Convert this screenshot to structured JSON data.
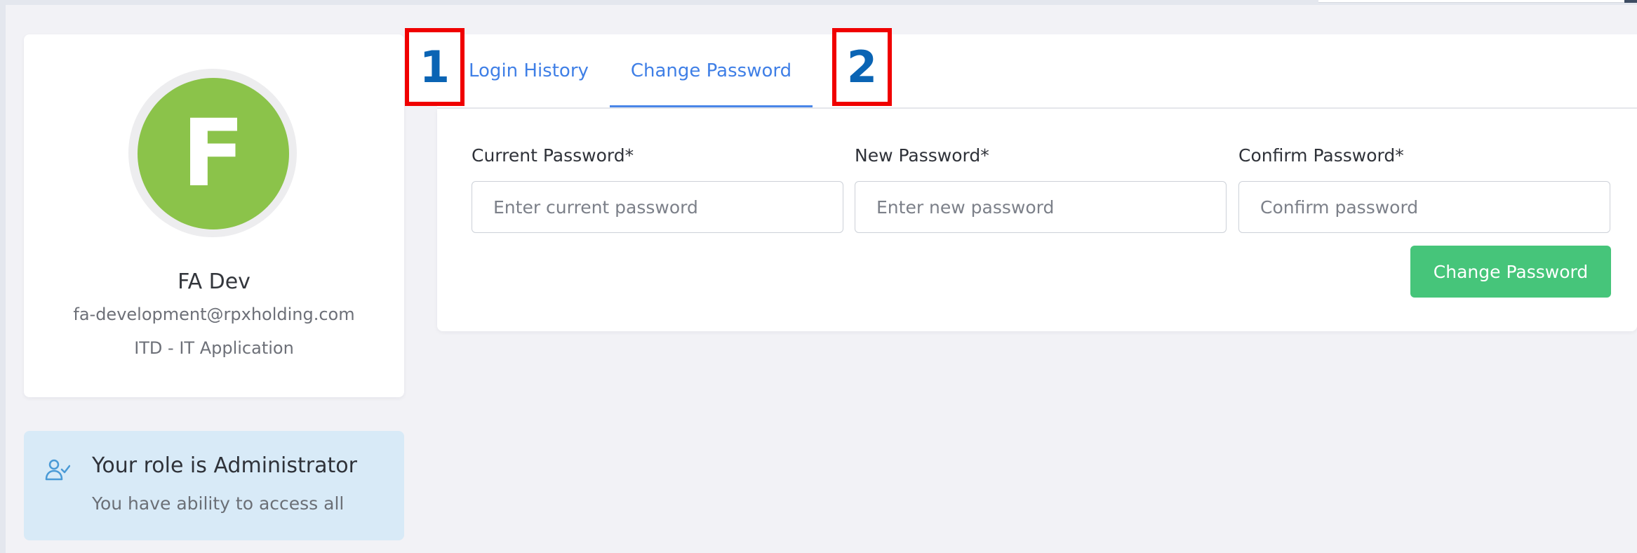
{
  "profile": {
    "avatar_initial": "F",
    "avatar_color": "#8bc34a",
    "name": "FA Dev",
    "email": "fa-development@rpxholding.com",
    "department": "ITD - IT Application"
  },
  "role": {
    "icon": "user-check-icon",
    "title": "Your role is Administrator",
    "subtitle": "You have ability to access all"
  },
  "tabs": [
    {
      "label": "Login History",
      "active": false
    },
    {
      "label": "Change Password",
      "active": true
    }
  ],
  "form": {
    "fields": [
      {
        "label": "Current Password*",
        "placeholder": "Enter current password"
      },
      {
        "label": "New Password*",
        "placeholder": "Enter new password"
      },
      {
        "label": "Confirm Password*",
        "placeholder": "Confirm password"
      }
    ],
    "submit_label": "Change Password",
    "submit_color": "#46c57a"
  },
  "annotations": [
    "1",
    "2"
  ],
  "colors": {
    "accent": "#4a86e8",
    "background": "#f2f2f6",
    "marker_border": "#f00000",
    "marker_text": "#0a64b4"
  }
}
